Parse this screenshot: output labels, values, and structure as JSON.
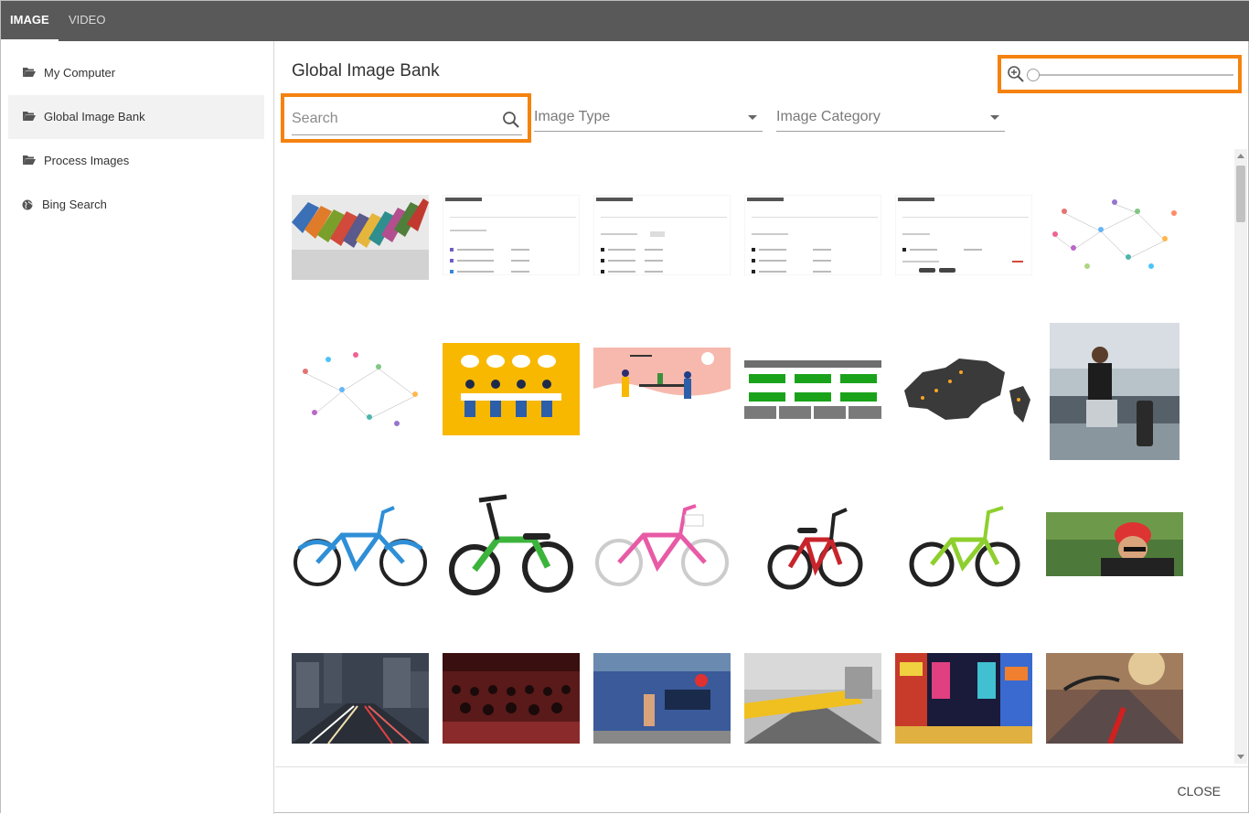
{
  "tabs": [
    {
      "label": "IMAGE",
      "active": true
    },
    {
      "label": "VIDEO",
      "active": false
    }
  ],
  "sidebar": {
    "items": [
      {
        "label": "My Computer",
        "icon": "folder-open-icon"
      },
      {
        "label": "Global Image Bank",
        "icon": "folder-open-icon",
        "active": true
      },
      {
        "label": "Process Images",
        "icon": "folder-open-icon"
      },
      {
        "label": "Bing Search",
        "icon": "globe-icon"
      }
    ]
  },
  "main": {
    "title": "Global Image Bank",
    "search_placeholder": "Search",
    "image_type_placeholder": "Image Type",
    "image_category_placeholder": "Image Category",
    "zoom_level": 0
  },
  "highlight_color": "#f5820f",
  "thumbnails": [
    {
      "name": "colored-books"
    },
    {
      "name": "site-directory-screenshot-1"
    },
    {
      "name": "site-directory-screenshot-2"
    },
    {
      "name": "site-directory-screenshot-3"
    },
    {
      "name": "site-directory-screenshot-4"
    },
    {
      "name": "people-network-1"
    },
    {
      "name": "people-network-2"
    },
    {
      "name": "meeting-illustration"
    },
    {
      "name": "office-illustration"
    },
    {
      "name": "process-diagram"
    },
    {
      "name": "europe-map"
    },
    {
      "name": "businesswoman-airport"
    },
    {
      "name": "blue-bicycle"
    },
    {
      "name": "green-balance-bike"
    },
    {
      "name": "pink-bicycle"
    },
    {
      "name": "red-bicycle"
    },
    {
      "name": "lime-bicycle"
    },
    {
      "name": "cyclist"
    },
    {
      "name": "city-night-traffic"
    },
    {
      "name": "theater-audience"
    },
    {
      "name": "berlin-wall"
    },
    {
      "name": "yellow-tram"
    },
    {
      "name": "times-square"
    },
    {
      "name": "bicycle-sunset"
    }
  ],
  "footer": {
    "close_label": "CLOSE"
  }
}
